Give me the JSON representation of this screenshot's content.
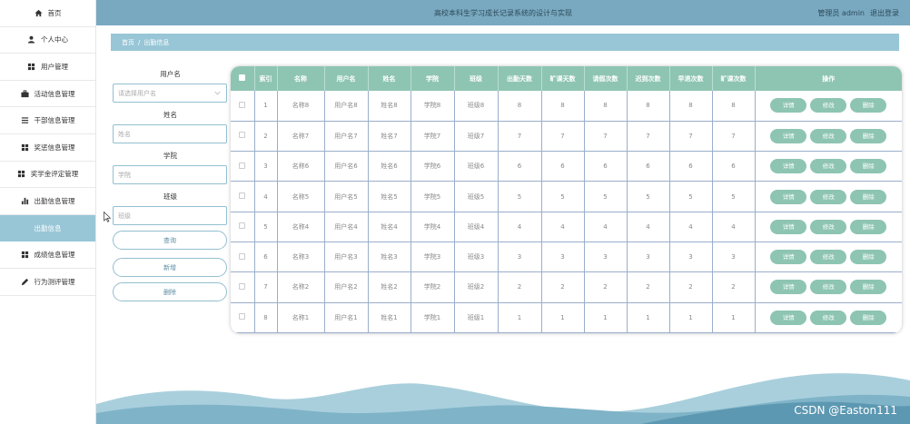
{
  "header": {
    "title": "高校本科生学习成长记录系统的设计与实现",
    "user_label": "管理员 admin",
    "logout": "退出登录"
  },
  "sidebar": {
    "items": [
      {
        "label": "首页",
        "icon": "home-icon"
      },
      {
        "label": "个人中心",
        "icon": "user-icon"
      },
      {
        "label": "用户管理",
        "icon": "grid-icon"
      },
      {
        "label": "活动信息管理",
        "icon": "briefcase-icon"
      },
      {
        "label": "干部信息管理",
        "icon": "list-icon"
      },
      {
        "label": "奖惩信息管理",
        "icon": "grid-icon"
      },
      {
        "label": "奖学金评定管理",
        "icon": "grid-icon"
      },
      {
        "label": "出勤信息管理",
        "icon": "bar-chart-icon"
      },
      {
        "label": "出勤信息",
        "icon": "",
        "active": true
      },
      {
        "label": "成绩信息管理",
        "icon": "grid-icon"
      },
      {
        "label": "行为测评管理",
        "icon": "pencil-icon"
      }
    ]
  },
  "breadcrumb": {
    "home": "首页",
    "separator": "/",
    "current": "出勤信息"
  },
  "search": {
    "username_label": "用户名",
    "username_placeholder": "请选择用户名",
    "name_label": "姓名",
    "name_placeholder": "姓名",
    "college_label": "学院",
    "college_placeholder": "学院",
    "class_label": "班级",
    "class_placeholder": "班级",
    "query_button": "查询",
    "add_button": "新增",
    "delete_button": "删除"
  },
  "table": {
    "headers": [
      "索引",
      "名称",
      "用户名",
      "姓名",
      "学院",
      "班级",
      "出勤天数",
      "旷课天数",
      "请假次数",
      "迟到次数",
      "早退次数",
      "旷课次数",
      "操作"
    ],
    "actions": {
      "detail": "详情",
      "edit": "修改",
      "delete": "删除"
    },
    "rows": [
      [
        "1",
        "名称8",
        "用户名8",
        "姓名8",
        "学院8",
        "班级8",
        "8",
        "8",
        "8",
        "8",
        "8",
        "8"
      ],
      [
        "2",
        "名称7",
        "用户名7",
        "姓名7",
        "学院7",
        "班级7",
        "7",
        "7",
        "7",
        "7",
        "7",
        "7"
      ],
      [
        "3",
        "名称6",
        "用户名6",
        "姓名6",
        "学院6",
        "班级6",
        "6",
        "6",
        "6",
        "6",
        "6",
        "6"
      ],
      [
        "4",
        "名称5",
        "用户名5",
        "姓名5",
        "学院5",
        "班级5",
        "5",
        "5",
        "5",
        "5",
        "5",
        "5"
      ],
      [
        "5",
        "名称4",
        "用户名4",
        "姓名4",
        "学院4",
        "班级4",
        "4",
        "4",
        "4",
        "4",
        "4",
        "4"
      ],
      [
        "6",
        "名称3",
        "用户名3",
        "姓名3",
        "学院3",
        "班级3",
        "3",
        "3",
        "3",
        "3",
        "3",
        "3"
      ],
      [
        "7",
        "名称2",
        "用户名2",
        "姓名2",
        "学院2",
        "班级2",
        "2",
        "2",
        "2",
        "2",
        "2",
        "2"
      ],
      [
        "8",
        "名称1",
        "用户名1",
        "姓名1",
        "学院1",
        "班级1",
        "1",
        "1",
        "1",
        "1",
        "1",
        "1"
      ]
    ]
  },
  "watermark": "CSDN @Easton111",
  "colors": {
    "header_bg": "#79a9c1",
    "breadcrumb_bg": "#98c6d6",
    "table_header_bg": "#8ec5b2",
    "action_button_bg": "#8ec5b2",
    "sidebar_active_bg": "#98c6d6"
  }
}
